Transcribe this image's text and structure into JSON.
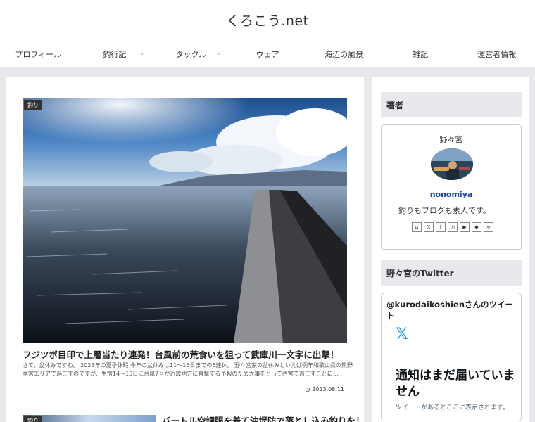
{
  "site": {
    "title": "くろこう.net"
  },
  "nav": [
    {
      "label": "プロフィール"
    },
    {
      "label": "釣行記"
    },
    {
      "label": "タックル"
    },
    {
      "label": "ウェア"
    },
    {
      "label": "海辺の風景"
    },
    {
      "label": "雑記"
    },
    {
      "label": "運営者情報"
    }
  ],
  "post1": {
    "category": "釣り",
    "title": "フジツボ目印で上層当たり連発！台風前の荒食いを狙って武庫川一文字に出撃！",
    "excerpt": "さて、盆休みですね。 2023年の夏季休暇 今年の盆休みは11〜16日までの6連休。 野々宮家の盆休みといえば例年和歌山県の熊野本宮エリアで過ごすのですが、生憎14〜15日に台風7号が近畿地方に直撃する予報のため大事をとって西宮で過ごすことに…",
    "date": "2023.08.11"
  },
  "post2": {
    "category": "釣り",
    "title": "バートル空調服を着て沖堤防で落とし込み釣りをしてきた"
  },
  "sidebar": {
    "author_heading": "著者",
    "author_name": "野々宮",
    "author_link": "nonomiya",
    "author_desc": "釣りもブログも素人です。",
    "twitter_heading": "野々宮のTwitter",
    "twitter_embed_title": "@kurodaikoshienさんのツイート",
    "twitter_x": "𝕏",
    "twitter_msg": "通知はまだ届いていません",
    "twitter_sub": "ツイートがあるとここに表示されます。"
  },
  "social_icons": [
    "home-icon",
    "x-icon",
    "facebook-icon",
    "instagram-icon",
    "youtube-icon",
    "feedly-icon",
    "rss-icon"
  ]
}
